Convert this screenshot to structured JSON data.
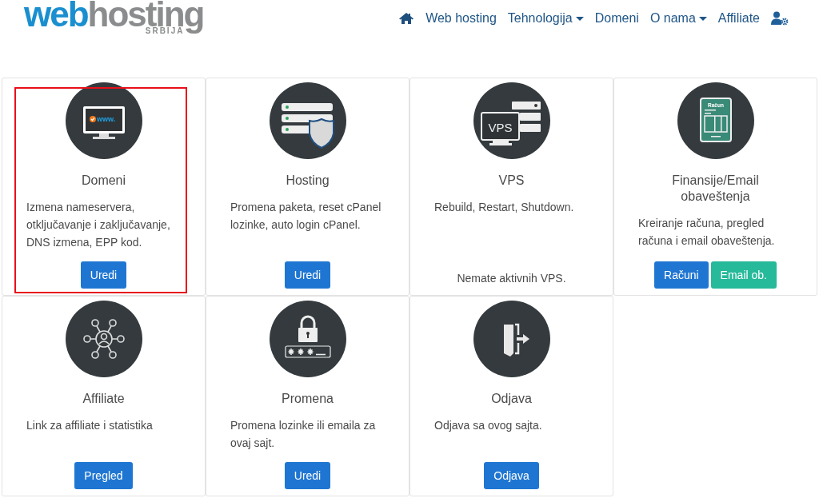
{
  "logo": {
    "parts": [
      "web",
      "hosting"
    ],
    "subtitle": "SRBIJA"
  },
  "nav": [
    {
      "kind": "home"
    },
    {
      "kind": "link",
      "label": "Web hosting",
      "dropdown": false
    },
    {
      "kind": "link",
      "label": "Tehnologija",
      "dropdown": true
    },
    {
      "kind": "link",
      "label": "Domeni",
      "dropdown": false
    },
    {
      "kind": "link",
      "label": "O nama",
      "dropdown": true
    },
    {
      "kind": "link",
      "label": "Affiliate",
      "dropdown": false
    },
    {
      "kind": "user"
    }
  ],
  "cards": [
    {
      "kind": "monitor",
      "icon_label": "www.",
      "title": "Domeni",
      "description": "Izmena nameservera, otključavanje i zaključavanje, DNS izmena, EPP kod.",
      "buttons": [
        {
          "label": "Uredi",
          "kind": "primary"
        }
      ],
      "highlighted": true
    },
    {
      "kind": "shield",
      "title": "Hosting",
      "description": "Promena paketa, reset cPanel lozinke, auto login cPanel.",
      "buttons": [
        {
          "label": "Uredi",
          "kind": "primary"
        }
      ],
      "highlighted": false
    },
    {
      "kind": "vps",
      "icon_label": "VPS",
      "title": "VPS",
      "description": "Rebuild, Restart, Shutdown.",
      "note": "Nemate aktivnih VPS.",
      "highlighted": false
    },
    {
      "kind": "invoice",
      "icon_label": "Račun",
      "title": "Finansije/Email obaveštenja",
      "description": "Kreiranje računa, pregled računa i email obaveštenja.",
      "buttons": [
        {
          "label": "Računi",
          "kind": "primary"
        },
        {
          "label": "Email ob.",
          "kind": "success"
        }
      ],
      "highlighted": false
    },
    {
      "kind": "network",
      "title": "Affiliate",
      "description": "Link za affiliate i statistika",
      "buttons": [
        {
          "label": "Pregled",
          "kind": "primary"
        }
      ],
      "highlighted": false
    },
    {
      "kind": "password",
      "title": "Promena",
      "description": "Promena lozinke ili emaila za ovaj sajt.",
      "buttons": [
        {
          "label": "Uredi",
          "kind": "primary"
        }
      ],
      "highlighted": false
    },
    {
      "kind": "logout",
      "title": "Odjava",
      "description": "Odjava sa ovog sajta.",
      "buttons": [
        {
          "label": "Odjava",
          "kind": "primary"
        }
      ],
      "highlighted": false
    }
  ]
}
